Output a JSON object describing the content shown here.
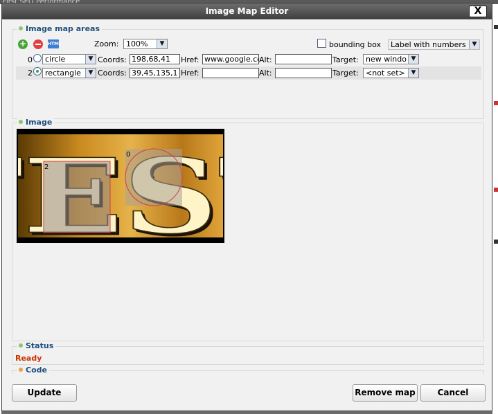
{
  "backdrop": {
    "top_text": "First    SEO    Performance"
  },
  "dialog": {
    "title": "Image Map Editor",
    "close_label": "X"
  },
  "areas_section": {
    "legend": "Image map areas",
    "toolbar": {
      "add_icon": "add-icon",
      "remove_icon": "remove-icon",
      "html_icon_label": "HTML",
      "zoom_label": "Zoom:",
      "zoom_value": "100%",
      "bounding_box_label": "bounding box",
      "bounding_box_checked": false,
      "label_mode_value": "Label with numbers"
    },
    "field_labels": {
      "coords": "Coords:",
      "href": "Href:",
      "alt": "Alt:",
      "target": "Target:"
    },
    "areas": [
      {
        "index": "0",
        "selected": false,
        "shape": "circle",
        "coords": "198,68,41",
        "href": "www.google.co",
        "alt": "",
        "target": "new windo"
      },
      {
        "index": "2",
        "selected": true,
        "shape": "rectangle",
        "coords": "39,45,135,1",
        "href": "",
        "alt": "",
        "target": "<not set>"
      }
    ]
  },
  "image_section": {
    "legend": "Image",
    "image_text": "TEST",
    "overlay_labels": [
      "0",
      "2"
    ]
  },
  "status_section": {
    "legend": "Status",
    "status_text": "Ready"
  },
  "code_section": {
    "legend": "Code"
  },
  "footer": {
    "update_label": "Update",
    "remove_map_label": "Remove map",
    "cancel_label": "Cancel"
  },
  "colors": {
    "titlebar": "#4a4a4a",
    "legend_text": "#1e4f7d",
    "status_ready": "#cc3300",
    "highlight_rect": "#e04040",
    "image_bg": "#c98a1f"
  }
}
